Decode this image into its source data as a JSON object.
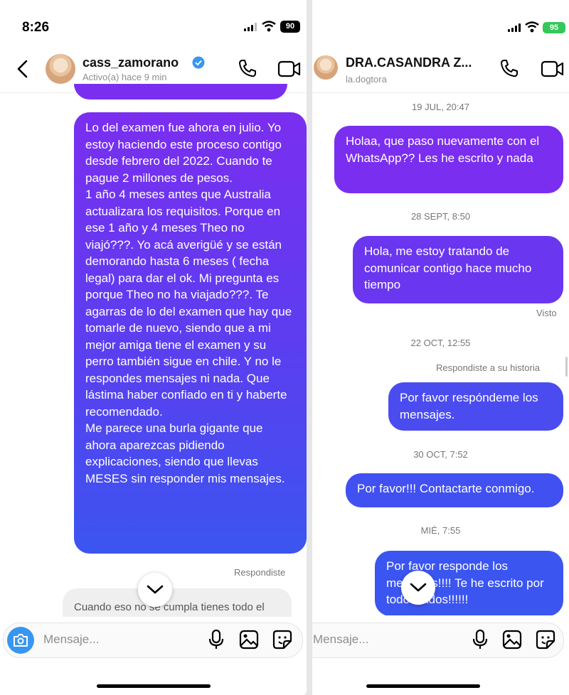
{
  "left": {
    "status": {
      "time": "8:26",
      "battery": "90"
    },
    "header": {
      "name": "cass_zamorano",
      "subtitle": "Activo(a) hace 9 min"
    },
    "messages": {
      "main_bubble": "Lo del examen fue ahora en julio. Yo estoy haciendo este proceso contigo desde febrero del 2022. Cuando te pague 2 millones de pesos.\n1 año 4 meses antes que Australia actualizara los requisitos. Porque en ese 1 año y 4 meses Theo no viajó???. Yo acá averigüé y se están demorando hasta 6 meses ( fecha legal) para dar el ok. Mi pregunta es porque Theo no ha viajado???. Te agarras de lo del examen que hay que tomarle de nuevo, siendo que a mi mejor amiga tiene el examen y su perro también sigue en chile. Y no le respondes mensajes ni nada. Que lástima haber confiado en ti y haberte recomendado.\nMe parece una burla gigante que ahora aparezcas pidiendo explicaciones, siendo que llevas MESES sin responder mis mensajes.",
      "replied_label": "Respondiste",
      "reply_preview": "Cuando eso no se cumpla tienes todo el derecho de reclamar"
    },
    "composer": {
      "placeholder": "Mensaje..."
    }
  },
  "right": {
    "status": {
      "battery": "95"
    },
    "header": {
      "name": "DRA.CASANDRA Z...",
      "subtitle": "la.dogtora"
    },
    "messages": {
      "ts1": "19 JUL, 20:47",
      "b1": "Holaa, que paso nuevamente con el WhatsApp?? Les he escrito y nada",
      "ts2": "28 SEPT, 8:50",
      "b2": "Hola, me estoy tratando de comunicar contigo hace mucho tiempo",
      "seen": "Visto",
      "ts3": "22 OCT, 12:55",
      "story_reply": "Respondiste a su historia",
      "b3": "Por favor respóndeme los mensajes.",
      "ts4": "30 OCT, 7:52",
      "b4": "Por favor!!! Contactarte conmigo.",
      "ts5": "MIÉ, 7:55",
      "b5": "Por favor responde los mensajes!!!! Te he escrito por todos lados!!!!!!"
    },
    "composer": {
      "placeholder": "Mensaje..."
    }
  },
  "colors": {
    "bubble_top": "#7a2ef0",
    "bubble_bottom": "#3b55f0",
    "bubble_mid": "#5a3ff0"
  }
}
